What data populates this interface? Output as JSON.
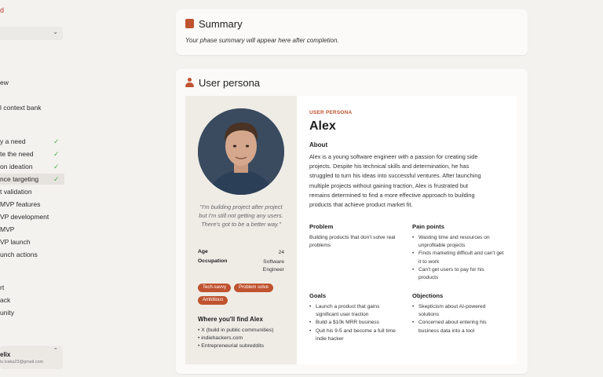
{
  "sidebar": {
    "top_label": "d",
    "chevron": "⌄",
    "items": [
      {
        "label": "ew",
        "checked": false
      },
      {
        "label": "l context bank",
        "checked": false
      },
      {
        "label": "y a need",
        "checked": true
      },
      {
        "label": "te the need",
        "checked": true
      },
      {
        "label": "on ideation",
        "checked": true
      },
      {
        "label": "nce targeting",
        "checked": true,
        "active": true
      },
      {
        "label": "t validation",
        "checked": false
      },
      {
        "label": "MVP features",
        "checked": false
      },
      {
        "label": "VP development",
        "checked": false
      },
      {
        "label": "MVP",
        "checked": false
      },
      {
        "label": "VP launch",
        "checked": false
      },
      {
        "label": "unch actions",
        "checked": false
      },
      {
        "label": "rt",
        "checked": false
      },
      {
        "label": "ack",
        "checked": false
      },
      {
        "label": "unity",
        "checked": false
      }
    ],
    "user": {
      "name": "elix",
      "email": "is.lvaka23@gmail.com",
      "chevron": "⌃"
    }
  },
  "summary": {
    "title": "Summary",
    "note": "Your phase summary will appear here after completion."
  },
  "persona": {
    "title": "User persona",
    "eyebrow": "USER PERSONA",
    "name": "Alex",
    "quote": "\"I'm building project after project but I'm still not getting any users. There's got to be a better way.\"",
    "age_label": "Age",
    "age": "24",
    "occupation_label": "Occupation",
    "occupation_1": "Software",
    "occupation_2": "Engineer",
    "tags": [
      "Tech-savvy",
      "Problem solve",
      "Ambitious"
    ],
    "where_title": "Where you'll find Alex",
    "where": [
      "X (build in public communities)",
      "indiehackers.com",
      "Entrepreneurial subreddits"
    ],
    "about_title": "About",
    "about": "Alex is a young software engineer with a passion for creating side projects. Despite his technical skills and determination, he has struggled to turn his ideas into successful ventures. After launching multiple projects without gaining traction, Alex is frustrated but remains determined to find a more effective approach to building products that achieve product market fit.",
    "problem_title": "Problem",
    "problem": "Building products that don't solve real problems",
    "pain_title": "Pain points",
    "pain": [
      "Wasting time and resources on unprofitable projects",
      "Finds marketing difficult and can't get it to work",
      "Can't get users to pay for his products"
    ],
    "goals_title": "Goals",
    "goals": [
      "Launch a product that gains significant user traction",
      "Build a $10k MRR business",
      "Quit his 9-5 and become a full time indie hacker"
    ],
    "objections_title": "Objections",
    "objections": [
      "Skepticism about AI-powered solutions",
      "Concerned about entering his business data into a tool"
    ]
  },
  "colors": {
    "accent": "#c0532f",
    "check": "#4caf50"
  }
}
